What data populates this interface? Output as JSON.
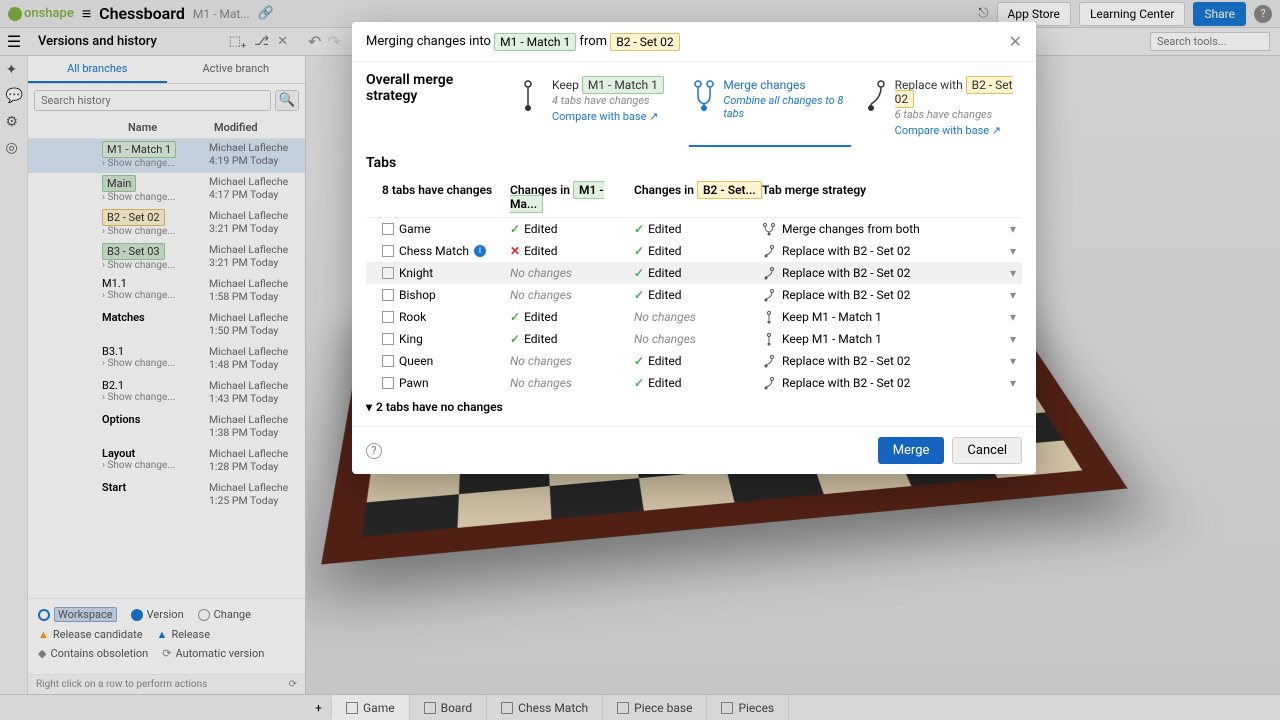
{
  "header": {
    "brand": "onshape",
    "doc_title": "Chessboard",
    "doc_sub": "M1 - Mat...",
    "app_store": "App Store",
    "learning_center": "Learning Center",
    "share": "Share"
  },
  "toolbar": {
    "versions_title": "Versions and history",
    "search_tools_placeholder": "Search tools..."
  },
  "versions": {
    "tabs": {
      "all": "All branches",
      "active": "Active branch"
    },
    "search_placeholder": "Search history",
    "columns": {
      "name": "Name",
      "modified": "Modified"
    },
    "rows": [
      {
        "label": "M1 - Match 1",
        "tag_class": "branch-tag",
        "show": "Show change...",
        "user": "Michael Lafleche",
        "time": "4:19 PM Today"
      },
      {
        "label": "Main",
        "tag_class": "branch-tag main",
        "show": "Show change...",
        "user": "Michael Lafleche",
        "time": "4:17 PM Today"
      },
      {
        "label": "B2 - Set 02",
        "tag_class": "branch-tag b2",
        "show": "Show change...",
        "user": "Michael Lafleche",
        "time": "3:21 PM Today"
      },
      {
        "label": "B3 - Set 03",
        "tag_class": "branch-tag b3",
        "show": "Show change...",
        "user": "Michael Lafleche",
        "time": "3:21 PM Today"
      },
      {
        "label": "M1.1",
        "plain": true,
        "show": "Show change...",
        "user": "Michael Lafleche",
        "time": "1:58 PM Today"
      },
      {
        "label": "Matches",
        "plain": true,
        "bold": true,
        "user": "Michael Lafleche",
        "time": "1:50 PM Today"
      },
      {
        "label": "B3.1",
        "plain": true,
        "show": "Show change...",
        "user": "Michael Lafleche",
        "time": "1:48 PM Today"
      },
      {
        "label": "B2.1",
        "plain": true,
        "show": "Show change...",
        "user": "Michael Lafleche",
        "time": "1:43 PM Today"
      },
      {
        "label": "Options",
        "plain": true,
        "bold": true,
        "user": "Michael Lafleche",
        "time": "1:38 PM Today"
      },
      {
        "label": "Layout",
        "plain": true,
        "bold": true,
        "show": "Show change...",
        "user": "Michael Lafleche",
        "time": "1:28 PM Today"
      },
      {
        "label": "Start",
        "plain": true,
        "bold": true,
        "user": "Michael Lafleche",
        "time": "1:25 PM Today"
      }
    ],
    "legend": {
      "workspace": "Workspace",
      "version": "Version",
      "change": "Change",
      "release_candidate": "Release candidate",
      "release": "Release",
      "obsoletion": "Contains obsoletion",
      "auto": "Automatic version"
    },
    "hint": "Right click on a row to perform actions"
  },
  "bottom_tabs": [
    "Game",
    "Board",
    "Chess Match",
    "Piece base",
    "Pieces"
  ],
  "modal": {
    "title_prefix": "Merging changes into",
    "title_target": "M1 - Match 1",
    "title_from": "from",
    "title_source": "B2 - Set 02",
    "strategy_label": "Overall merge strategy",
    "opts": {
      "keep": {
        "title_pre": "Keep ",
        "title_tag": "M1 - Match 1",
        "sub": "4 tabs have changes",
        "link": "Compare with base ↗"
      },
      "merge": {
        "title": "Merge changes",
        "sub": "Combine all changes to 8 tabs"
      },
      "replace": {
        "title_pre": "Replace with ",
        "title_tag": "B2 - Set 02",
        "sub": "6 tabs have changes",
        "link": "Compare with base ↗"
      }
    },
    "tabs_label": "Tabs",
    "table": {
      "col1": "8 tabs have changes",
      "col2_pre": "Changes in ",
      "col2_tag": "M1 - Ma...",
      "col3_pre": "Changes in ",
      "col3_tag": "B2 - Set...",
      "col4": "Tab merge strategy",
      "rows": [
        {
          "name": "Game",
          "c1": "edited",
          "c2": "edited",
          "strategy": "Merge changes from both",
          "sicon": "merge"
        },
        {
          "name": "Chess Match",
          "info": true,
          "c1": "conflict",
          "c2": "edited",
          "strategy": "Replace with B2 - Set 02",
          "sicon": "replace"
        },
        {
          "name": "Knight",
          "hover": true,
          "c1": "none",
          "c2": "edited",
          "strategy": "Replace with B2 - Set 02",
          "sicon": "replace"
        },
        {
          "name": "Bishop",
          "c1": "none",
          "c2": "edited",
          "strategy": "Replace with B2 - Set 02",
          "sicon": "replace"
        },
        {
          "name": "Rook",
          "c1": "edited",
          "c2": "none",
          "strategy": "Keep M1 - Match 1",
          "sicon": "keep"
        },
        {
          "name": "King",
          "c1": "edited",
          "c2": "none",
          "strategy": "Keep M1 - Match 1",
          "sicon": "keep"
        },
        {
          "name": "Queen",
          "c1": "none",
          "c2": "edited",
          "strategy": "Replace with B2 - Set 02",
          "sicon": "replace"
        },
        {
          "name": "Pawn",
          "c1": "none",
          "c2": "edited",
          "strategy": "Replace with B2 - Set 02",
          "sicon": "replace"
        }
      ],
      "edited_label": "Edited",
      "nochange_label": "No changes",
      "collapse": "2 tabs have no changes"
    },
    "buttons": {
      "merge": "Merge",
      "cancel": "Cancel"
    }
  }
}
